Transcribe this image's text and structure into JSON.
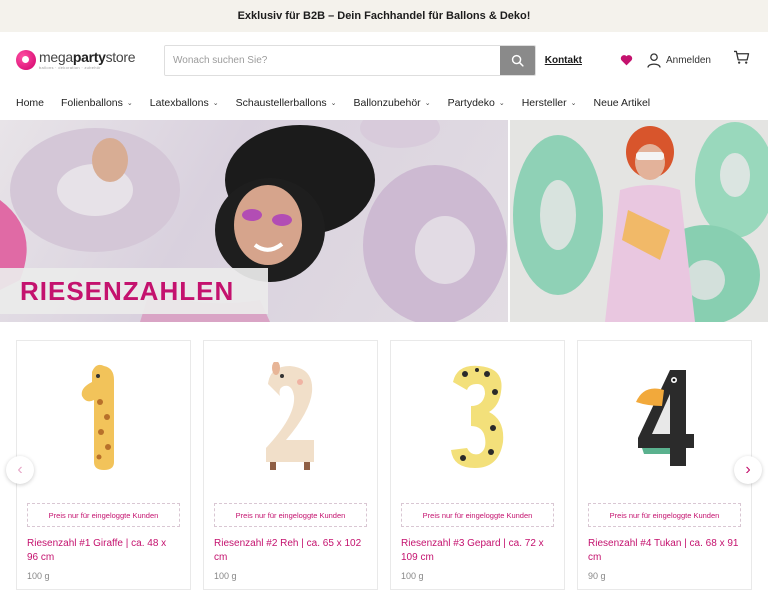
{
  "announcement": "Exklusiv für B2B – Dein Fachhandel für Ballons & Deko!",
  "logo": {
    "brand_light": "mega",
    "brand_bold": "party",
    "brand_end": "store",
    "tagline": "ballons · dekoration · zubehör"
  },
  "search": {
    "placeholder": "Wonach suchen Sie?"
  },
  "header": {
    "contact_label": "Kontakt",
    "login_label": "Anmelden"
  },
  "nav": [
    {
      "label": "Home",
      "has_dropdown": false
    },
    {
      "label": "Folienballons",
      "has_dropdown": true
    },
    {
      "label": "Latexballons",
      "has_dropdown": true
    },
    {
      "label": "Schaustellerballons",
      "has_dropdown": true
    },
    {
      "label": "Ballonzubehör",
      "has_dropdown": true
    },
    {
      "label": "Partydeko",
      "has_dropdown": true
    },
    {
      "label": "Hersteller",
      "has_dropdown": true
    },
    {
      "label": "Neue Artikel",
      "has_dropdown": false
    }
  ],
  "hero": {
    "headline": "RIESENZAHLEN"
  },
  "products": [
    {
      "price_note": "Preis nur für eingeloggte Kunden",
      "title": "Riesenzahl #1 Giraffe | ca. 48 x 96 cm",
      "sub": "100 g"
    },
    {
      "price_note": "Preis nur für eingeloggte Kunden",
      "title": "Riesenzahl #2 Reh | ca. 65 x 102 cm",
      "sub": "100 g"
    },
    {
      "price_note": "Preis nur für eingeloggte Kunden",
      "title": "Riesenzahl #3 Gepard | ca. 72 x 109 cm",
      "sub": "100 g"
    },
    {
      "price_note": "Preis nur für eingeloggte Kunden",
      "title": "Riesenzahl #4 Tukan | ca. 68 x 91 cm",
      "sub": "90 g"
    }
  ],
  "colors": {
    "brand": "#c4126e",
    "announce_bg": "#f4f2ec",
    "search_button": "#8a8a8a"
  }
}
